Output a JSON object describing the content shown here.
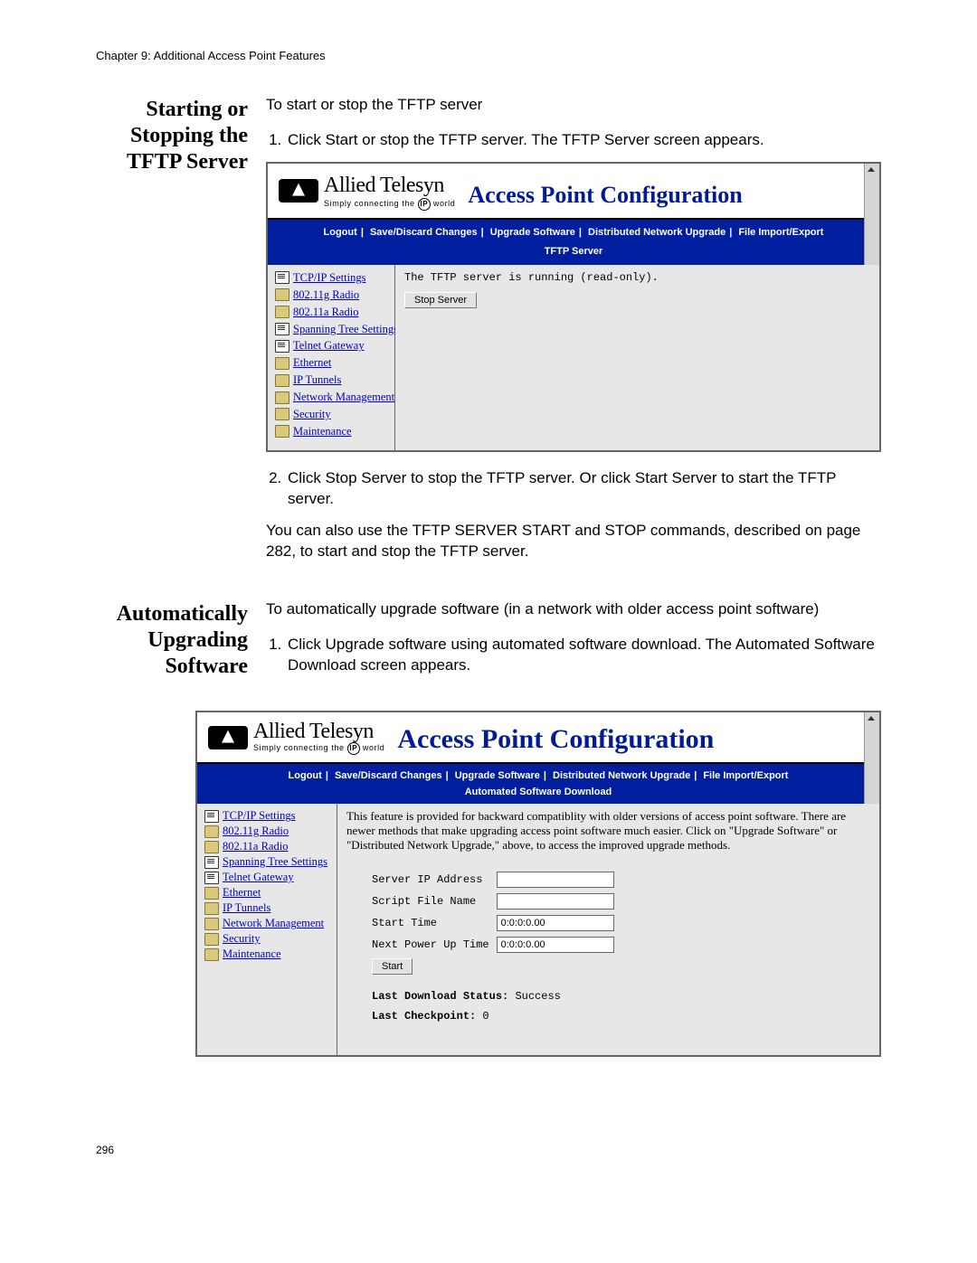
{
  "chapter_header": "Chapter 9: Additional Access Point Features",
  "page_number": "296",
  "section1": {
    "heading": "Starting or Stopping the TFTP Server",
    "intro": "To start or stop the TFTP server",
    "step1": "Click Start or stop the TFTP server. The TFTP Server screen appears.",
    "step2": "Click Stop Server to stop the TFTP server. Or click Start Server to start the TFTP server.",
    "tail": "You can also use the TFTP SERVER START and STOP commands, described on page 282, to start and stop the TFTP server."
  },
  "section2": {
    "heading": "Automatically Upgrading Software",
    "intro": "To automatically upgrade software (in a network with older access point software)",
    "step1": "Click Upgrade software using automated software download. The Automated Software Download screen appears."
  },
  "shot_common": {
    "brand_main": "Allied Telesyn",
    "brand_sub_prefix": "Simply connecting the",
    "brand_sub_suffix": "world",
    "brand_ip": "IP",
    "title": "Access Point Configuration",
    "menu": {
      "logout": "Logout",
      "save": "Save/Discard Changes",
      "upgrade": "Upgrade Software",
      "dnu": "Distributed Network Upgrade",
      "fie": "File Import/Export"
    },
    "sidebar": [
      {
        "icon": "doc",
        "label": "TCP/IP Settings"
      },
      {
        "icon": "folder",
        "label": "802.11g Radio"
      },
      {
        "icon": "folder",
        "label": "802.11a Radio"
      },
      {
        "icon": "doc",
        "label": "Spanning Tree Settings"
      },
      {
        "icon": "doc",
        "label": "Telnet Gateway"
      },
      {
        "icon": "folder",
        "label": "Ethernet"
      },
      {
        "icon": "folder",
        "label": "IP Tunnels"
      },
      {
        "icon": "folder",
        "label": "Network Management"
      },
      {
        "icon": "folder",
        "label": "Security"
      },
      {
        "icon": "folder",
        "label": "Maintenance"
      }
    ]
  },
  "shot1": {
    "subtitle_bar": "TFTP Server",
    "status_line": "The TFTP server is running (read-only).",
    "button": "Stop Server"
  },
  "shot2": {
    "subtitle_bar": "Automated Software Download",
    "note": "This feature is provided for backward compatiblity with older versions of access point software. There are newer methods that make upgrading access point software much easier. Click on \"Upgrade Software\" or \"Distributed Network Upgrade,\" above, to access the improved upgrade methods.",
    "fields": {
      "server_ip_label": "Server IP Address",
      "server_ip_value": "",
      "script_label": "Script File Name",
      "script_value": "",
      "start_time_label": "Start Time",
      "start_time_value": "0:0:0:0.00",
      "next_label": "Next Power Up Time",
      "next_value": "0:0:0:0.00",
      "start_button": "Start"
    },
    "last_status_label": "Last Download Status:",
    "last_status_value": "Success",
    "last_checkpoint_label": "Last Checkpoint:",
    "last_checkpoint_value": "0"
  }
}
